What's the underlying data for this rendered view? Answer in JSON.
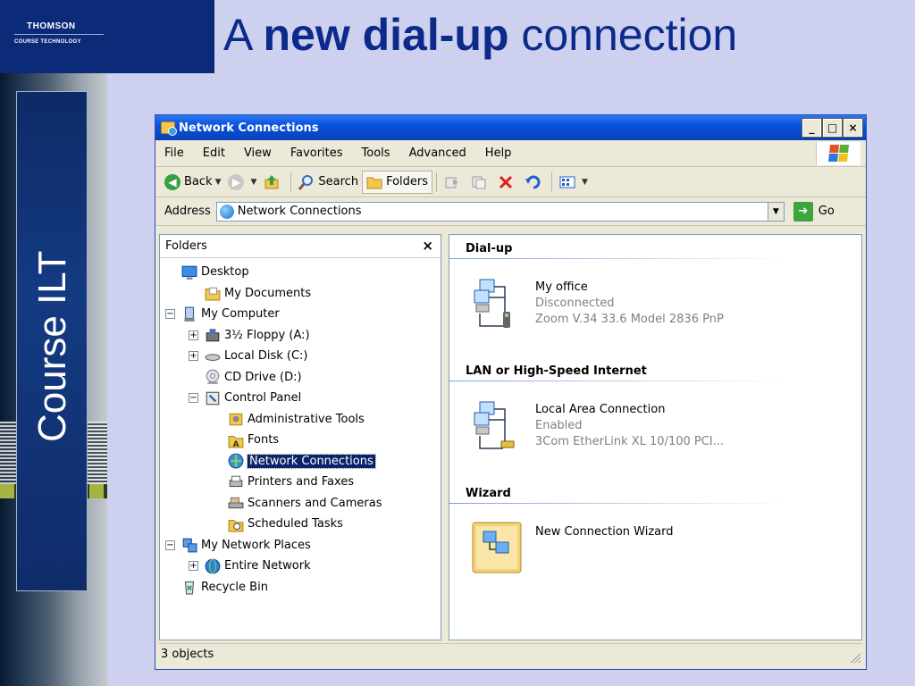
{
  "slide": {
    "brand_line1": "THOMSON",
    "brand_line2": "COURSE TECHNOLOGY",
    "title_prefix": "A ",
    "title_bold": "new dial-up",
    "title_suffix": " connection",
    "side_label": "Course ILT"
  },
  "window": {
    "title": "Network Connections",
    "controls": {
      "minimize": "_",
      "maximize": "□",
      "close": "×"
    }
  },
  "menu": [
    "File",
    "Edit",
    "View",
    "Favorites",
    "Tools",
    "Advanced",
    "Help"
  ],
  "toolbar": {
    "back": "Back",
    "search": "Search",
    "folders": "Folders"
  },
  "address": {
    "label": "Address",
    "value": "Network Connections",
    "go": "Go"
  },
  "folders_pane": {
    "title": "Folders",
    "close": "×",
    "tree": [
      {
        "label": "Desktop",
        "level": 0,
        "toggle": "",
        "icon": "desktop-icon"
      },
      {
        "label": "My Documents",
        "level": 1,
        "toggle": "",
        "icon": "my-documents-icon"
      },
      {
        "label": "My Computer",
        "level": 0,
        "toggle": "−",
        "icon": "my-computer-icon"
      },
      {
        "label": "3½ Floppy (A:)",
        "level": 1,
        "toggle": "+",
        "icon": "floppy-icon"
      },
      {
        "label": "Local Disk (C:)",
        "level": 1,
        "toggle": "+",
        "icon": "hard-disk-icon"
      },
      {
        "label": "CD Drive (D:)",
        "level": 1,
        "toggle": "",
        "icon": "cd-drive-icon"
      },
      {
        "label": "Control Panel",
        "level": 1,
        "toggle": "−",
        "icon": "control-panel-icon"
      },
      {
        "label": "Administrative Tools",
        "level": 2,
        "toggle": "",
        "icon": "admin-tools-icon"
      },
      {
        "label": "Fonts",
        "level": 2,
        "toggle": "",
        "icon": "fonts-folder-icon"
      },
      {
        "label": "Network Connections",
        "level": 2,
        "toggle": "",
        "icon": "network-connections-icon",
        "selected": true
      },
      {
        "label": "Printers and Faxes",
        "level": 2,
        "toggle": "",
        "icon": "printer-icon"
      },
      {
        "label": "Scanners and Cameras",
        "level": 2,
        "toggle": "",
        "icon": "scanner-icon"
      },
      {
        "label": "Scheduled Tasks",
        "level": 2,
        "toggle": "",
        "icon": "scheduled-tasks-icon"
      },
      {
        "label": "My Network Places",
        "level": 0,
        "toggle": "−",
        "icon": "network-places-icon"
      },
      {
        "label": "Entire Network",
        "level": 1,
        "toggle": "+",
        "icon": "entire-network-icon"
      },
      {
        "label": "Recycle Bin",
        "level": 0,
        "toggle": "",
        "icon": "recycle-bin-icon"
      }
    ]
  },
  "groups": [
    {
      "header": "Dial-up",
      "items": [
        {
          "name": "My office",
          "status": "Disconnected",
          "device": "Zoom V.34 33.6 Model 2836 PnP",
          "icon": "dialup-connection-icon"
        }
      ]
    },
    {
      "header": "LAN or High-Speed Internet",
      "items": [
        {
          "name": "Local Area Connection",
          "status": "Enabled",
          "device": "3Com EtherLink XL 10/100 PCI...",
          "icon": "lan-connection-icon"
        }
      ]
    },
    {
      "header": "Wizard",
      "items": [
        {
          "name": "New Connection Wizard",
          "status": "",
          "device": "",
          "icon": "new-connection-wizard-icon"
        }
      ]
    }
  ],
  "status": {
    "text": "3 objects"
  }
}
